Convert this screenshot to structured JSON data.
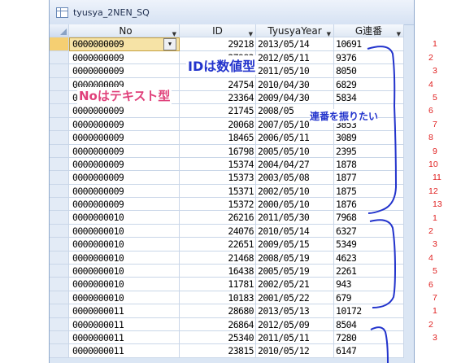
{
  "window": {
    "title": "tyusya_2NEN_SQ"
  },
  "columns": [
    {
      "label": "No",
      "dropdown": true
    },
    {
      "label": "ID",
      "dropdown": true
    },
    {
      "label": "TyusyaYear",
      "dropdown": true
    },
    {
      "label": "G連番",
      "dropdown": true
    }
  ],
  "rows": [
    {
      "no": "0000000009",
      "id": "29218",
      "year": "2013/05/14",
      "g": "10691"
    },
    {
      "no": "0000000009",
      "id": "27983",
      "year": "2012/05/11",
      "g": "9376"
    },
    {
      "no": "0000000009",
      "id": "26253",
      "year": "2011/05/10",
      "g": "8050"
    },
    {
      "no": "0000000009",
      "id": "24754",
      "year": "2010/04/30",
      "g": "6829"
    },
    {
      "no": "0000000009",
      "id": "23364",
      "year": "2009/04/30",
      "g": "5834"
    },
    {
      "no": "0000000009",
      "id": "21745",
      "year": "2008/05",
      "g": ""
    },
    {
      "no": "0000000009",
      "id": "20068",
      "year": "2007/05/10",
      "g": "3853"
    },
    {
      "no": "0000000009",
      "id": "18465",
      "year": "2006/05/11",
      "g": "3089"
    },
    {
      "no": "0000000009",
      "id": "16798",
      "year": "2005/05/10",
      "g": "2395"
    },
    {
      "no": "0000000009",
      "id": "15374",
      "year": "2004/04/27",
      "g": "1878"
    },
    {
      "no": "0000000009",
      "id": "15373",
      "year": "2003/05/08",
      "g": "1877"
    },
    {
      "no": "0000000009",
      "id": "15371",
      "year": "2002/05/10",
      "g": "1875"
    },
    {
      "no": "0000000009",
      "id": "15372",
      "year": "2000/05/10",
      "g": "1876"
    },
    {
      "no": "0000000010",
      "id": "26216",
      "year": "2011/05/30",
      "g": "7968"
    },
    {
      "no": "0000000010",
      "id": "24076",
      "year": "2010/05/14",
      "g": "6327"
    },
    {
      "no": "0000000010",
      "id": "22651",
      "year": "2009/05/15",
      "g": "5349"
    },
    {
      "no": "0000000010",
      "id": "21468",
      "year": "2008/05/19",
      "g": "4623"
    },
    {
      "no": "0000000010",
      "id": "16438",
      "year": "2005/05/19",
      "g": "2261"
    },
    {
      "no": "0000000010",
      "id": "11781",
      "year": "2002/05/21",
      "g": "943"
    },
    {
      "no": "0000000010",
      "id": "10183",
      "year": "2001/05/22",
      "g": "679"
    },
    {
      "no": "0000000011",
      "id": "28680",
      "year": "2013/05/13",
      "g": "10172"
    },
    {
      "no": "0000000011",
      "id": "26864",
      "year": "2012/05/09",
      "g": "8504"
    },
    {
      "no": "0000000011",
      "id": "25340",
      "year": "2011/05/11",
      "g": "7280"
    },
    {
      "no": "0000000011",
      "id": "23815",
      "year": "2010/05/12",
      "g": "6147"
    }
  ],
  "annotations": {
    "id_note": "IDは数値型",
    "no_note": "Noはテキスト型",
    "seq_note": "連番を振りたい",
    "color_blue": "#2233cc",
    "color_pink": "#e0407a",
    "color_red": "#e02020"
  },
  "group1_numbers": [
    "1",
    "2",
    "3",
    "4",
    "5",
    "6",
    "7",
    "8",
    "9",
    "10",
    "11",
    "12",
    "13"
  ],
  "group2_numbers": [
    "1",
    "2",
    "3",
    "4",
    "5",
    "6",
    "7"
  ],
  "group3_numbers": [
    "1",
    "2",
    "3"
  ]
}
